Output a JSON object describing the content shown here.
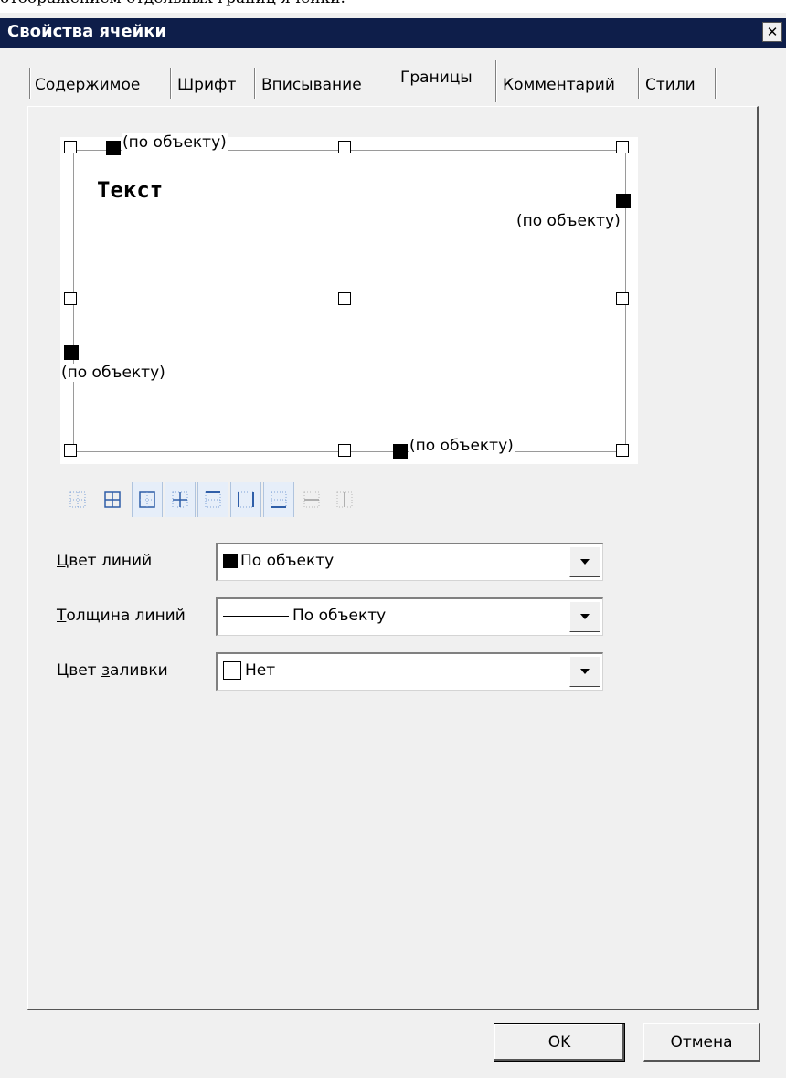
{
  "page_caption": "отображением отдельных границ ячейки.",
  "window": {
    "title": "Свойства ячейки",
    "close_glyph": "✕"
  },
  "tabs": [
    {
      "label": "Содержимое",
      "active": false
    },
    {
      "label": "Шрифт",
      "active": false
    },
    {
      "label": "Вписывание",
      "active": false
    },
    {
      "label": "Границы",
      "active": true
    },
    {
      "label": "Комментарий",
      "active": false
    },
    {
      "label": "Стили",
      "active": false
    }
  ],
  "preview": {
    "sample_text": "Текст",
    "top_label": "(по объекту)",
    "right_label": "(по объекту)",
    "left_label": "(по объекту)",
    "bottom_label": "(по объекту)"
  },
  "presets": [
    {
      "icon": "border-none-icon",
      "selected": false
    },
    {
      "icon": "border-all-icon",
      "selected": false
    },
    {
      "icon": "border-outer-icon",
      "selected": true
    },
    {
      "icon": "border-inner-icon",
      "selected": true
    },
    {
      "icon": "border-top-icon",
      "selected": true
    },
    {
      "icon": "border-left-right-icon",
      "selected": true
    },
    {
      "icon": "border-bottom-icon",
      "selected": true
    },
    {
      "icon": "border-horizontal-icon",
      "selected": false
    },
    {
      "icon": "border-vertical-icon",
      "selected": false
    }
  ],
  "fields": {
    "line_color": {
      "label_underlined": "Ц",
      "label_rest": "вет линий",
      "value": "По объекту",
      "swatch": "#000000"
    },
    "line_width": {
      "label_underlined": "Т",
      "label_rest": "олщина линий",
      "value": "По объекту"
    },
    "fill_color": {
      "label_before": "Цвет ",
      "label_underlined": "з",
      "label_rest": "аливки",
      "value": "Нет",
      "swatch": "#ffffff"
    }
  },
  "buttons": {
    "ok": "OK",
    "cancel": "Отмена"
  },
  "colors": {
    "titlebar": "#0e1e4a",
    "dialog_bg": "#f0f0f0",
    "preset_icon": "#3a6cc4"
  }
}
